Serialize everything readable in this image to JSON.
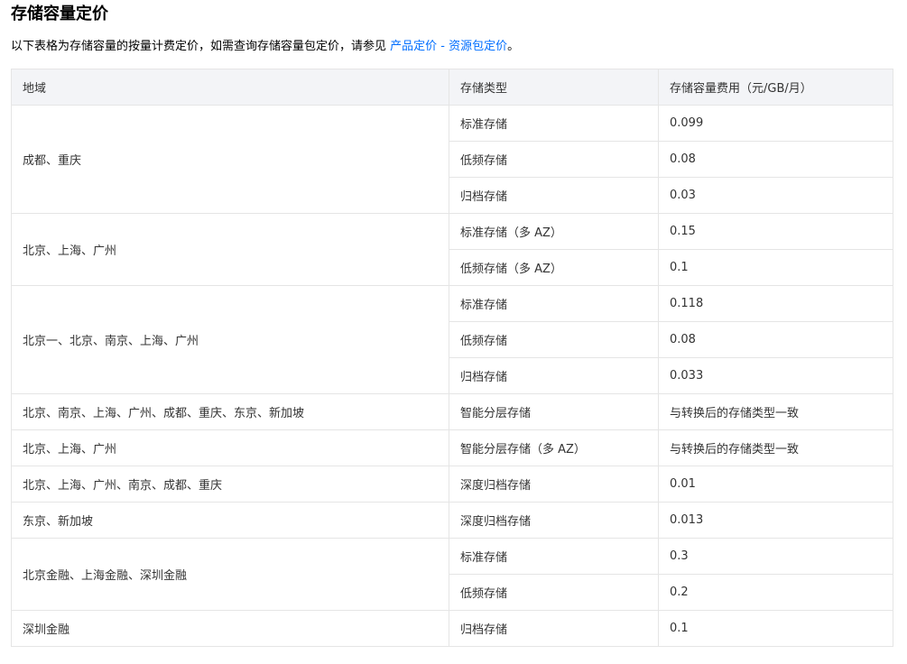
{
  "page_title": "存储容量定价",
  "intro": {
    "text_before": "以下表格为存储容量的按量计费定价，如需查询存储容量包定价，请参见 ",
    "link_text": "产品定价 - 资源包定价",
    "text_after": "。",
    "link_color": "#006eff"
  },
  "table": {
    "headers": [
      "地域",
      "存储类型",
      "存储容量费用（元/GB/月）"
    ],
    "groups": [
      {
        "region": "成都、重庆",
        "rows": [
          {
            "type": "标准存储",
            "price": "0.099"
          },
          {
            "type": "低频存储",
            "price": "0.08"
          },
          {
            "type": "归档存储",
            "price": "0.03"
          }
        ]
      },
      {
        "region": "北京、上海、广州",
        "rows": [
          {
            "type": "标准存储（多 AZ）",
            "price": "0.15"
          },
          {
            "type": "低频存储（多 AZ）",
            "price": "0.1"
          }
        ]
      },
      {
        "region": "北京一、北京、南京、上海、广州",
        "rows": [
          {
            "type": "标准存储",
            "price": "0.118"
          },
          {
            "type": "低频存储",
            "price": "0.08"
          },
          {
            "type": "归档存储",
            "price": "0.033"
          }
        ]
      },
      {
        "region": "北京、南京、上海、广州、成都、重庆、东京、新加坡",
        "rows": [
          {
            "type": "智能分层存储",
            "price": "与转换后的存储类型一致"
          }
        ]
      },
      {
        "region": "北京、上海、广州",
        "rows": [
          {
            "type": "智能分层存储（多 AZ）",
            "price": "与转换后的存储类型一致"
          }
        ]
      },
      {
        "region": "北京、上海、广州、南京、成都、重庆",
        "rows": [
          {
            "type": "深度归档存储",
            "price": "0.01"
          }
        ]
      },
      {
        "region": "东京、新加坡",
        "rows": [
          {
            "type": "深度归档存储",
            "price": "0.013"
          }
        ]
      },
      {
        "region": "北京金融、上海金融、深圳金融",
        "rows": [
          {
            "type": "标准存储",
            "price": "0.3"
          },
          {
            "type": "低频存储",
            "price": "0.2"
          }
        ]
      },
      {
        "region": "深圳金融",
        "rows": [
          {
            "type": "归档存储",
            "price": "0.1"
          }
        ]
      }
    ]
  }
}
